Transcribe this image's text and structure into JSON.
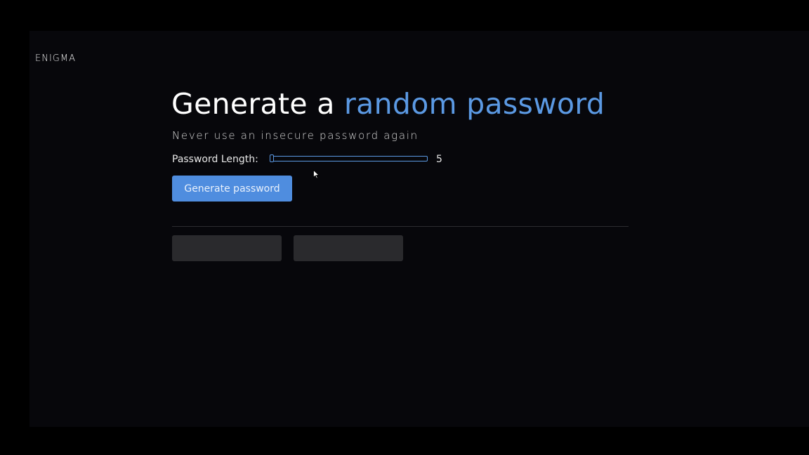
{
  "app": {
    "logo": "ENIGMA"
  },
  "hero": {
    "title_plain": "Generate a",
    "title_accent": "random password",
    "subtitle": "Never use an insecure password again"
  },
  "length": {
    "label": "Password Length:",
    "value": "5",
    "slider_fraction": 0.0
  },
  "actions": {
    "generate_label": "Generate password"
  },
  "results": {
    "password_1": "",
    "password_2": ""
  },
  "colors": {
    "accent": "#5b99e3",
    "button": "#4f8ddf",
    "background": "#07070b",
    "result_box": "#2a2a2d"
  },
  "icons": {
    "cursor": "arrow-pointer-icon"
  }
}
